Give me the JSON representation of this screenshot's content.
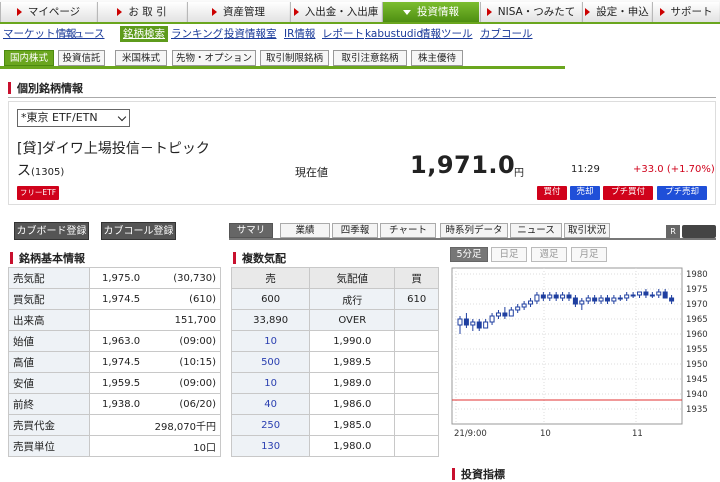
{
  "nav": [
    "マイページ",
    "お 取 引",
    "資産管理",
    "入出金・入出庫",
    "投資情報",
    "NISA・つみたてNISA",
    "設定・申込",
    "サポート"
  ],
  "subnav": [
    "マーケット情報",
    "ニュース",
    "銘柄検索",
    "ランキング",
    "投資情報室",
    "IR情報",
    "レポート",
    "kabustudio",
    "情報ツール",
    "カブコール"
  ],
  "market_tabs": [
    "国内株式",
    "投資信託",
    "米国株式",
    "先物・オプション",
    "取引制限銘柄",
    "取引注意銘柄",
    "株主優待"
  ],
  "section_title": "個別銘柄情報",
  "market_select": "*東京 ETF/ETN",
  "stock": {
    "name_line1": "[貸]ダイワ上場投信－トピック",
    "name_line2": "ス",
    "code": "(1305)",
    "badge": "フリーETF",
    "price_label": "現在値",
    "price": "1,971.0",
    "unit": "円",
    "time": "11:29",
    "change": "+33.0 (+1.70%)"
  },
  "trade_buttons": [
    "買付",
    "売却",
    "プチ買付",
    "プチ売却"
  ],
  "register_buttons": [
    "カブボード登録",
    "カブコール登録"
  ],
  "info_tabs": [
    "サマリ",
    "業績",
    "四季報",
    "チャート",
    "時系列データ",
    "ニュース",
    "取引状況"
  ],
  "basic": {
    "title": "銘柄基本情報",
    "rows": [
      {
        "k": "売気配",
        "v": "1,975.0",
        "s": "(30,730)"
      },
      {
        "k": "買気配",
        "v": "1,974.5",
        "s": "(610)"
      },
      {
        "k": "出来高",
        "v": "",
        "s": "151,700"
      },
      {
        "k": "始値",
        "v": "1,963.0",
        "s": "(09:00)"
      },
      {
        "k": "高値",
        "v": "1,974.5",
        "s": "(10:15)"
      },
      {
        "k": "安値",
        "v": "1,959.5",
        "s": "(09:00)"
      },
      {
        "k": "前終",
        "v": "1,938.0",
        "s": "(06/20)"
      },
      {
        "k": "売買代金",
        "v": "",
        "s": "298,070千円"
      },
      {
        "k": "売買単位",
        "v": "",
        "s": "10口"
      }
    ]
  },
  "board": {
    "title": "複数気配",
    "headers": [
      "売",
      "気配値",
      "買"
    ],
    "rows": [
      {
        "sell": "600",
        "price": "成行",
        "buy": "610"
      },
      {
        "sell": "33,890",
        "price": "OVER",
        "buy": ""
      },
      {
        "sell": "10",
        "price": "1,990.0",
        "buy": ""
      },
      {
        "sell": "500",
        "price": "1,989.5",
        "buy": ""
      },
      {
        "sell": "10",
        "price": "1,989.0",
        "buy": ""
      },
      {
        "sell": "40",
        "price": "1,986.0",
        "buy": ""
      },
      {
        "sell": "250",
        "price": "1,985.0",
        "buy": ""
      },
      {
        "sell": "130",
        "price": "1,980.0",
        "buy": ""
      }
    ]
  },
  "chart_tabs": [
    "5分足",
    "日足",
    "週足",
    "月足"
  ],
  "chart_extra": "R",
  "chart_data": {
    "type": "candlestick",
    "interval": "5分足",
    "ylim": [
      1930,
      1982
    ],
    "y_ticks": [
      1980,
      1975,
      1970,
      1965,
      1960,
      1955,
      1950,
      1945,
      1940,
      1935
    ],
    "x_ticks": [
      "21/9:00",
      "10",
      "11"
    ],
    "reference_line": 1938.0,
    "candles": [
      {
        "o": 1963,
        "h": 1966,
        "l": 1960,
        "c": 1965
      },
      {
        "o": 1965,
        "h": 1967,
        "l": 1962,
        "c": 1963
      },
      {
        "o": 1963,
        "h": 1965,
        "l": 1961,
        "c": 1964
      },
      {
        "o": 1964,
        "h": 1965,
        "l": 1961,
        "c": 1962
      },
      {
        "o": 1962,
        "h": 1965,
        "l": 1962,
        "c": 1964
      },
      {
        "o": 1964,
        "h": 1967,
        "l": 1963,
        "c": 1966
      },
      {
        "o": 1966,
        "h": 1968,
        "l": 1965,
        "c": 1967
      },
      {
        "o": 1967,
        "h": 1969,
        "l": 1965,
        "c": 1966
      },
      {
        "o": 1966,
        "h": 1969,
        "l": 1966,
        "c": 1968
      },
      {
        "o": 1968,
        "h": 1970,
        "l": 1967,
        "c": 1969
      },
      {
        "o": 1969,
        "h": 1971,
        "l": 1968,
        "c": 1970
      },
      {
        "o": 1970,
        "h": 1972,
        "l": 1969,
        "c": 1971
      },
      {
        "o": 1971,
        "h": 1974,
        "l": 1970,
        "c": 1973
      },
      {
        "o": 1973,
        "h": 1974,
        "l": 1971,
        "c": 1972
      },
      {
        "o": 1972,
        "h": 1974,
        "l": 1971,
        "c": 1973
      },
      {
        "o": 1973,
        "h": 1974,
        "l": 1971,
        "c": 1972
      },
      {
        "o": 1972,
        "h": 1974,
        "l": 1971,
        "c": 1973
      },
      {
        "o": 1973,
        "h": 1974,
        "l": 1971,
        "c": 1972
      },
      {
        "o": 1972,
        "h": 1973,
        "l": 1969,
        "c": 1970
      },
      {
        "o": 1970,
        "h": 1972,
        "l": 1968,
        "c": 1971
      },
      {
        "o": 1971,
        "h": 1973,
        "l": 1970,
        "c": 1972
      },
      {
        "o": 1972,
        "h": 1973,
        "l": 1970,
        "c": 1971
      },
      {
        "o": 1971,
        "h": 1973,
        "l": 1970,
        "c": 1972
      },
      {
        "o": 1972,
        "h": 1973,
        "l": 1970,
        "c": 1971
      },
      {
        "o": 1971,
        "h": 1973,
        "l": 1970,
        "c": 1972
      },
      {
        "o": 1972,
        "h": 1973,
        "l": 1971,
        "c": 1972
      },
      {
        "o": 1972,
        "h": 1974,
        "l": 1971,
        "c": 1973
      },
      {
        "o": 1973,
        "h": 1974,
        "l": 1972,
        "c": 1973
      },
      {
        "o": 1973,
        "h": 1974,
        "l": 1972,
        "c": 1974
      },
      {
        "o": 1974,
        "h": 1975,
        "l": 1972,
        "c": 1973
      },
      {
        "o": 1973,
        "h": 1974,
        "l": 1972,
        "c": 1973
      },
      {
        "o": 1973,
        "h": 1975,
        "l": 1972,
        "c": 1974
      },
      {
        "o": 1974,
        "h": 1975,
        "l": 1972,
        "c": 1972
      },
      {
        "o": 1972,
        "h": 1973,
        "l": 1970,
        "c": 1971
      }
    ]
  },
  "indicator_title": "投資指標",
  "colors": {
    "accent": "#6aa61e",
    "red": "#d0021b",
    "blue": "#1f4fd8",
    "up": "#1f3fa0",
    "down": "#1f3fa0"
  }
}
